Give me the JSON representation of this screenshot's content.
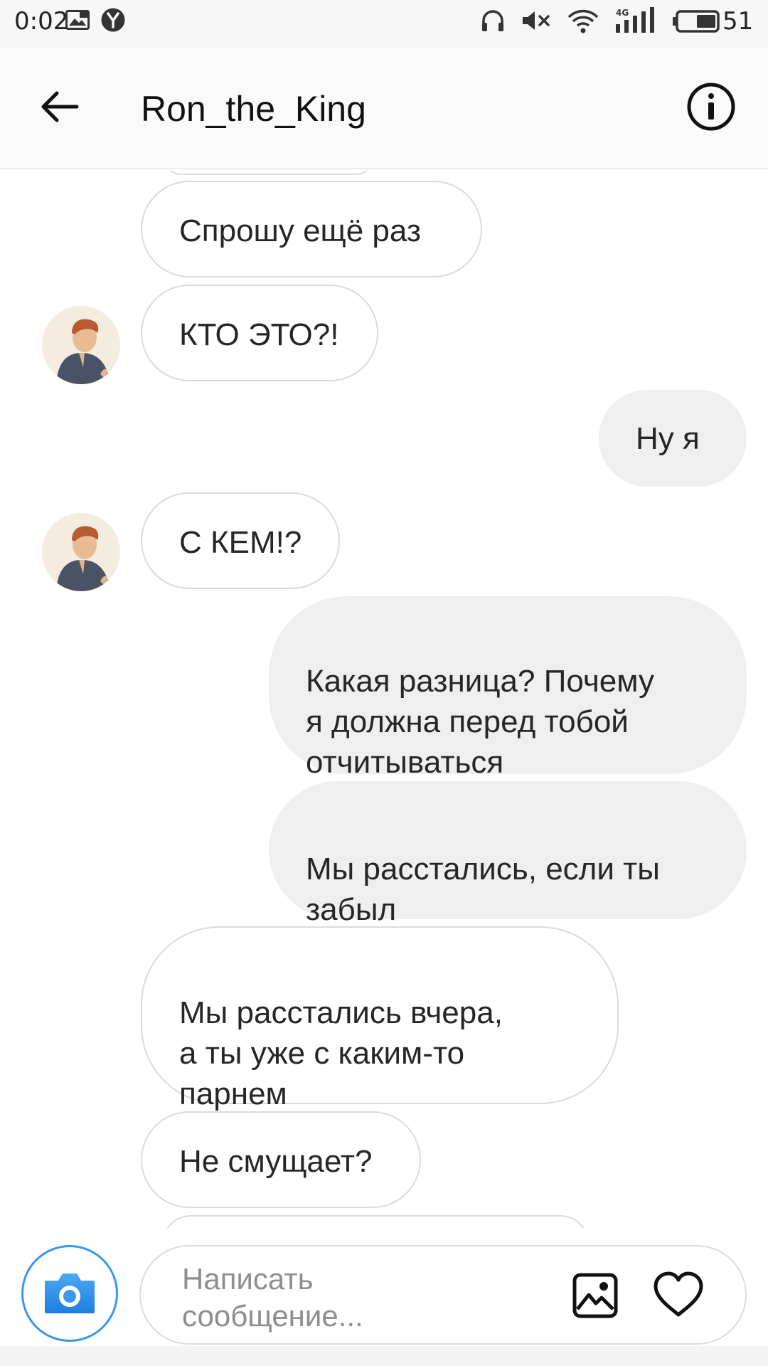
{
  "status_bar": {
    "time": "0:02",
    "battery_level": "51",
    "icons": [
      "gallery-notification-icon",
      "yandex-icon",
      "headphones-icon",
      "mute-icon",
      "wifi-icon",
      "signal-4g-icon",
      "battery-icon"
    ]
  },
  "header": {
    "title": "Ron_the_King",
    "back_icon": "back-arrow-icon",
    "info_icon": "info-icon"
  },
  "messages": [
    {
      "side": "in",
      "text": "Спрошу ещё раз"
    },
    {
      "side": "in",
      "text": "КТО ЭТО?!",
      "avatar": true
    },
    {
      "side": "out",
      "text": "Ну я"
    },
    {
      "side": "in",
      "text": "С КЕМ!?",
      "avatar": true
    },
    {
      "side": "out",
      "text": "Какая разница? Почему\nя должна перед тобой\nотчитываться"
    },
    {
      "side": "out",
      "text": "Мы расстались, если ты\nзабыл"
    },
    {
      "side": "in",
      "text": "Мы расстались вчера,\nа ты уже с каким-то\nпарнем"
    },
    {
      "side": "in",
      "text": "Не смущает?"
    }
  ],
  "composer": {
    "placeholder": "Написать\nсообщение...",
    "camera_icon": "camera-icon",
    "gallery_icon": "gallery-icon",
    "like_icon": "heart-icon"
  },
  "colors": {
    "accent_blue": "#3897f0",
    "incoming_border": "#dbdbdb",
    "outgoing_bg": "#efefef"
  }
}
